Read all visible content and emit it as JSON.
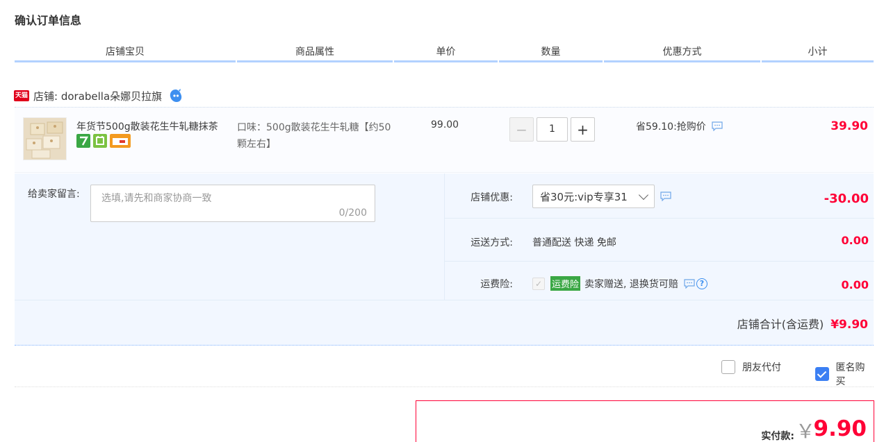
{
  "page": {
    "title": "确认订单信息"
  },
  "columns": [
    {
      "label": "店铺宝贝"
    },
    {
      "label": "商品属性"
    },
    {
      "label": "单价"
    },
    {
      "label": "数量"
    },
    {
      "label": "优惠方式"
    },
    {
      "label": "小计"
    }
  ],
  "shop": {
    "badge": "天猫",
    "label": "店铺: dorabella朵娜贝拉旗",
    "chat_icon": "wangwang-chat-icon"
  },
  "item": {
    "title": "年货节500g散装花生牛轧糖抹茶",
    "attr": "口味：500g散装花生牛轧糖【约50颗左右】",
    "price": "99.00",
    "quantity": "1",
    "qty_minus": "−",
    "qty_plus": "+",
    "promo": "省59.10:抢购价",
    "subtotal": "39.90"
  },
  "memo": {
    "label": "给卖家留言:",
    "placeholder": "选填,请先和商家协商一致",
    "count": "0/200"
  },
  "coupon": {
    "label": "店铺优惠:",
    "selected": "省30元:vip专享31",
    "amount": "-30.00"
  },
  "shipping": {
    "label": "运送方式:",
    "value": "普通配送 快递 免邮",
    "amount": "0.00"
  },
  "insurance": {
    "label": "运费险:",
    "badge": "运费险",
    "text": "卖家赠送, 退换货可赔",
    "help": "?",
    "amount": "0.00"
  },
  "shop_total": {
    "label": "店铺合计(含运费)",
    "value": "¥9.90"
  },
  "options": {
    "friend_pay": "朋友代付",
    "anonymous": "匿名购买"
  },
  "payment": {
    "label": "实付款:",
    "currency": "￥",
    "amount": "9.90"
  },
  "colors": {
    "accent_red": "#ff0036",
    "header_underline": "#b2d1ff",
    "panel_bg": "#f2f7ff",
    "checkbox_blue": "#3b7ff3"
  }
}
